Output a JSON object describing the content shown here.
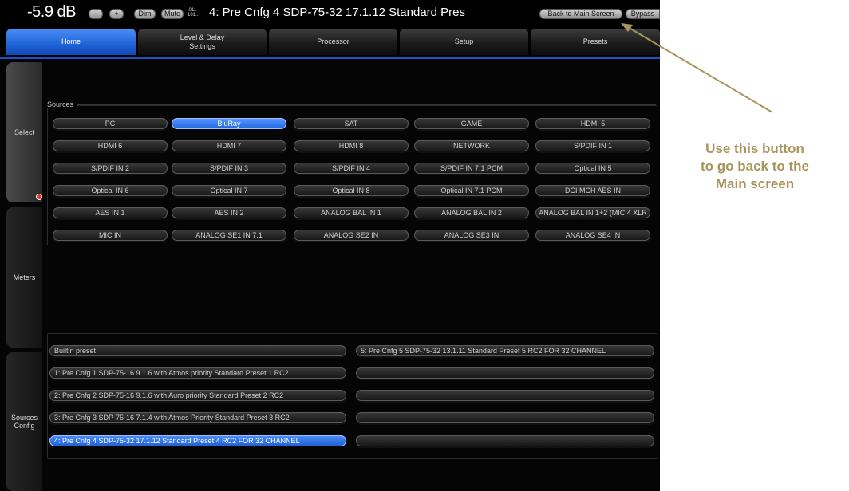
{
  "topbar": {
    "volume": "-5.9 dB",
    "minus": "-",
    "plus": "+",
    "dim": "Dim",
    "mute": "Mute",
    "bitrate_top": ".011",
    "bitrate_bottom": "101..",
    "preset_title": "4: Pre Cnfg 4  SDP-75-32  17.1.12  Standard Pres",
    "back_main": "Back to Main Screen",
    "bypass": "Bypass"
  },
  "tabs": [
    {
      "label": "Home",
      "active": true
    },
    {
      "label": "Level & Delay",
      "label2": "Settings"
    },
    {
      "label": "Processor"
    },
    {
      "label": "Setup"
    },
    {
      "label": "Presets"
    }
  ],
  "sidebar": {
    "select": "Select",
    "meters": "Meters",
    "sources_config_1": "Sources",
    "sources_config_2": "Config"
  },
  "sources": {
    "title": "Sources",
    "buttons": [
      "PC",
      "BluRay",
      "SAT",
      "GAME",
      "HDMI 5",
      "HDMI 6",
      "HDMI 7",
      "HDMI 8",
      "NETWORK",
      "S/PDIF IN 1",
      "S/PDIF IN 2",
      "S/PDIF IN 3",
      "S/PDIF IN 4",
      "S/PDIF IN 7.1 PCM",
      "Optical IN 5",
      "Optical IN 6",
      "Optical IN 7",
      "Optical IN 8",
      "Optical IN 7.1 PCM",
      "DCI MCH AES IN",
      "AES IN 1",
      "AES IN 2",
      "ANALOG BAL IN 1",
      "ANALOG BAL IN 2",
      "ANALOG BAL IN 1+2 (MIC 4 XLR",
      "MIC IN",
      "ANALOG SE1 IN 7.1",
      "ANALOG SE2 IN",
      "ANALOG SE3 IN",
      "ANALOG SE4 IN"
    ],
    "selected": "BluRay"
  },
  "presets": {
    "left": [
      "Builtin preset",
      "1: Pre Cnfg 1  SDP-75-16  9.1.6  with  Atmos priority  Standard Preset 1  RC2",
      "2: Pre Cnfg 2  SDP-75-16  9.1.6  with Auro priority  Standard Preset 2   RC2",
      "3: Pre Cnfg 3  SDP-75-16  7.1.4 with Atmos Priority  Standard Preset 3  RC2",
      "4: Pre Cnfg 4  SDP-75-32  17.1.12  Standard Preset 4  RC2  FOR 32 CHANNEL"
    ],
    "right": [
      "5: Pre Cnfg 5  SDP-75-32   13.1.11  Standard Preset 5  RC2  FOR 32 CHANNEL",
      "",
      "",
      "",
      ""
    ],
    "selected_index": 4
  },
  "annotation": {
    "line1": "Use this button",
    "line2": "to go back to the",
    "line3": "Main screen",
    "color": "#a8955c"
  },
  "colors": {
    "accent_blue": "#1f63d8",
    "background": "#050505",
    "alert_dot": "#e0302a"
  }
}
